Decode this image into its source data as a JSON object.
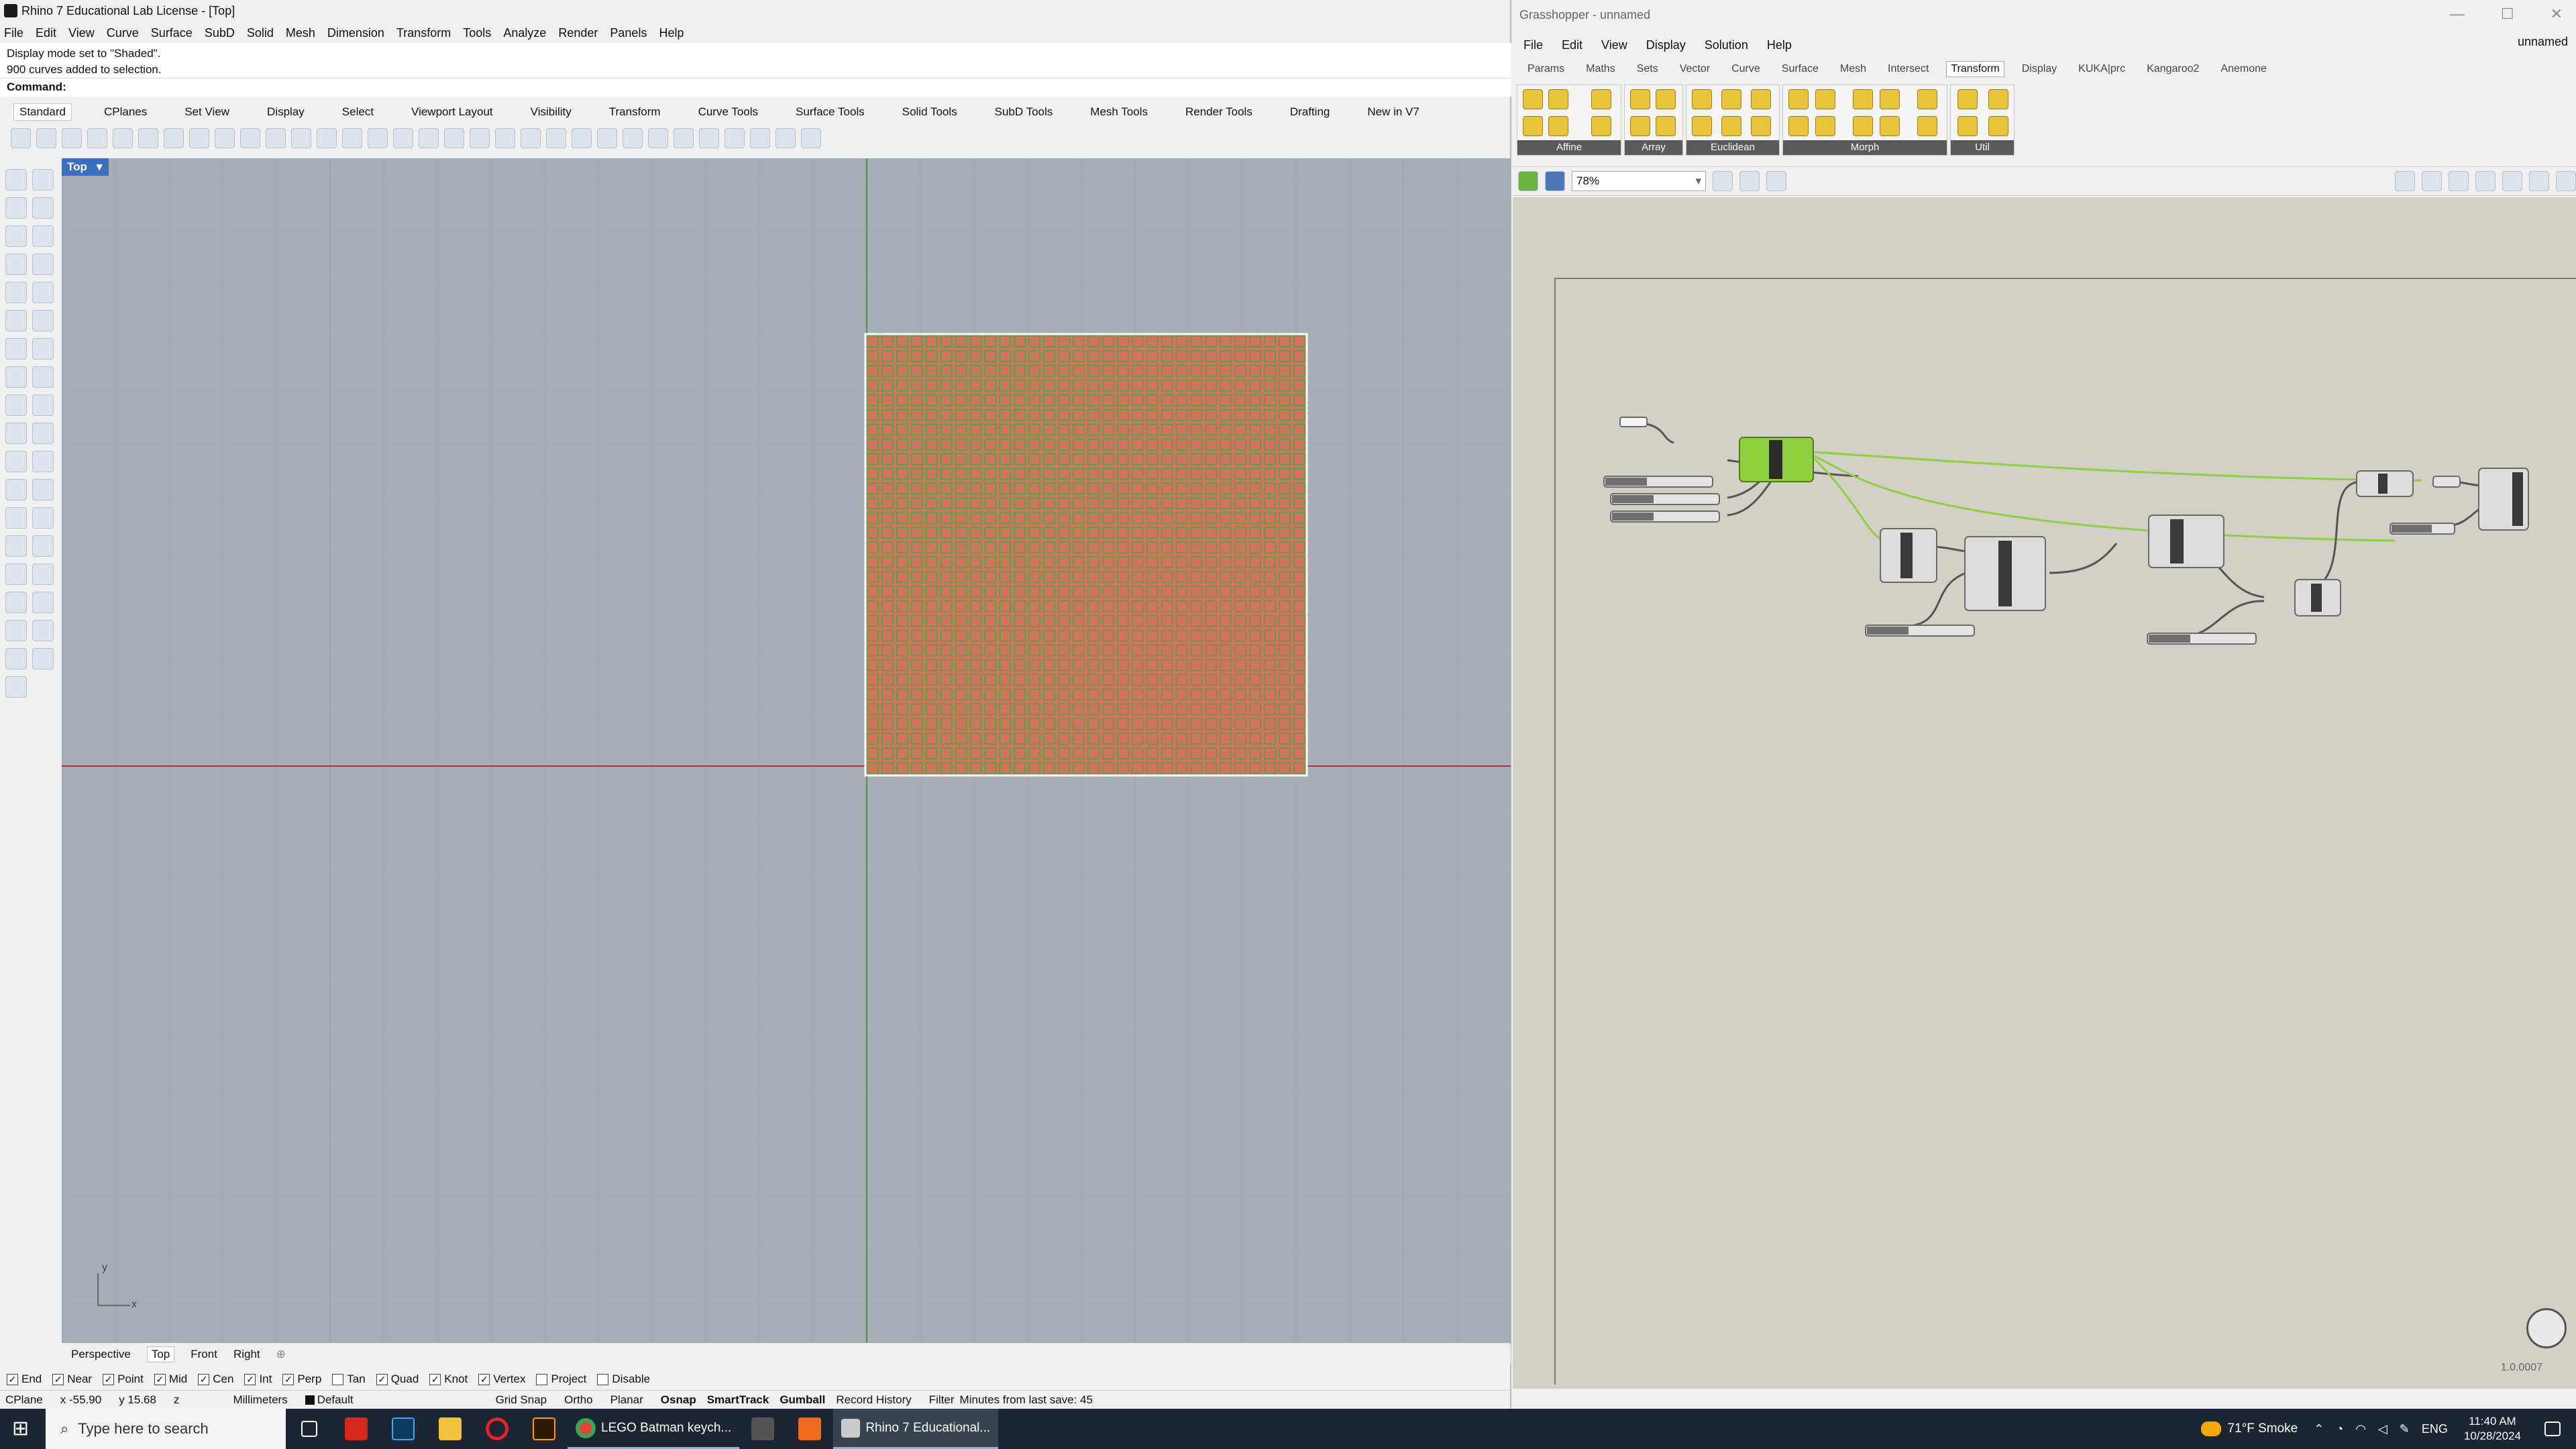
{
  "rhino": {
    "title": "Rhino 7 Educational Lab License - [Top]",
    "menu": [
      "File",
      "Edit",
      "View",
      "Curve",
      "Surface",
      "SubD",
      "Solid",
      "Mesh",
      "Dimension",
      "Transform",
      "Tools",
      "Analyze",
      "Render",
      "Panels",
      "Help"
    ],
    "history": [
      "Display mode set to \"Shaded\".",
      "900 curves added to selection."
    ],
    "command_label": "Command:",
    "tabs": [
      "Standard",
      "CPlanes",
      "Set View",
      "Display",
      "Select",
      "Viewport Layout",
      "Visibility",
      "Transform",
      "Curve Tools",
      "Surface Tools",
      "Solid Tools",
      "SubD Tools",
      "Mesh Tools",
      "Render Tools",
      "Drafting",
      "New in V7"
    ],
    "active_tab": "Standard",
    "viewport_name": "Top",
    "axis_y": "y",
    "axis_x": "x",
    "viewport_tabs": [
      "Perspective",
      "Top",
      "Front",
      "Right"
    ],
    "active_viewport_tab": "Top",
    "osnaps": [
      {
        "label": "End",
        "checked": true
      },
      {
        "label": "Near",
        "checked": true
      },
      {
        "label": "Point",
        "checked": true
      },
      {
        "label": "Mid",
        "checked": true
      },
      {
        "label": "Cen",
        "checked": true
      },
      {
        "label": "Int",
        "checked": true
      },
      {
        "label": "Perp",
        "checked": true
      },
      {
        "label": "Tan",
        "checked": false
      },
      {
        "label": "Quad",
        "checked": true
      },
      {
        "label": "Knot",
        "checked": true
      },
      {
        "label": "Vertex",
        "checked": true
      },
      {
        "label": "Project",
        "checked": false
      },
      {
        "label": "Disable",
        "checked": false
      }
    ],
    "status": {
      "cplane": "CPlane",
      "x": "x -55.90",
      "y": "y 15.68",
      "z": "z",
      "units": "Millimeters",
      "layer": "Default",
      "grid_snap": "Grid Snap",
      "ortho": "Ortho",
      "planar": "Planar",
      "osnap": "Osnap",
      "smarttrack": "SmartTrack",
      "gumball": "Gumball",
      "record_history": "Record History",
      "filter": "Filter",
      "save_msg": "Minutes from last save: 45"
    },
    "colors": {
      "viewport_bg": "#a7adb4",
      "grid_fill": "#d0745f",
      "grid_line": "#3fae3f",
      "viewport_label": "#3a6ec0"
    }
  },
  "gh": {
    "title": "Grasshopper - unnamed",
    "doc_name": "unnamed",
    "menu": [
      "File",
      "Edit",
      "View",
      "Display",
      "Solution",
      "Help"
    ],
    "tabs": [
      "Params",
      "Maths",
      "Sets",
      "Vector",
      "Curve",
      "Surface",
      "Mesh",
      "Intersect",
      "Transform",
      "Display",
      "KUKA|prc",
      "Kangaroo2",
      "Anemone"
    ],
    "active_tab": "Transform",
    "groups": [
      "Affine",
      "Array",
      "Euclidean",
      "Morph",
      "Util"
    ],
    "zoom": "78%",
    "version": "1.0.0007",
    "colors": {
      "canvas_bg": "#d3d0c8",
      "component": "#dcdcdc",
      "active_component": "#8fd13d",
      "wire": "#555555",
      "wire_active": "#8fd13d"
    }
  },
  "taskbar": {
    "search_placeholder": "Type here to search",
    "apps": [
      {
        "label": "LEGO Batman keych...",
        "icon": "chrome-icon"
      },
      {
        "label": "Rhino 7 Educational...",
        "icon": "rhino-icon"
      }
    ],
    "weather": "71°F Smoke",
    "lang": "ENG",
    "time": "11:40 AM",
    "date": "10/28/2024"
  }
}
